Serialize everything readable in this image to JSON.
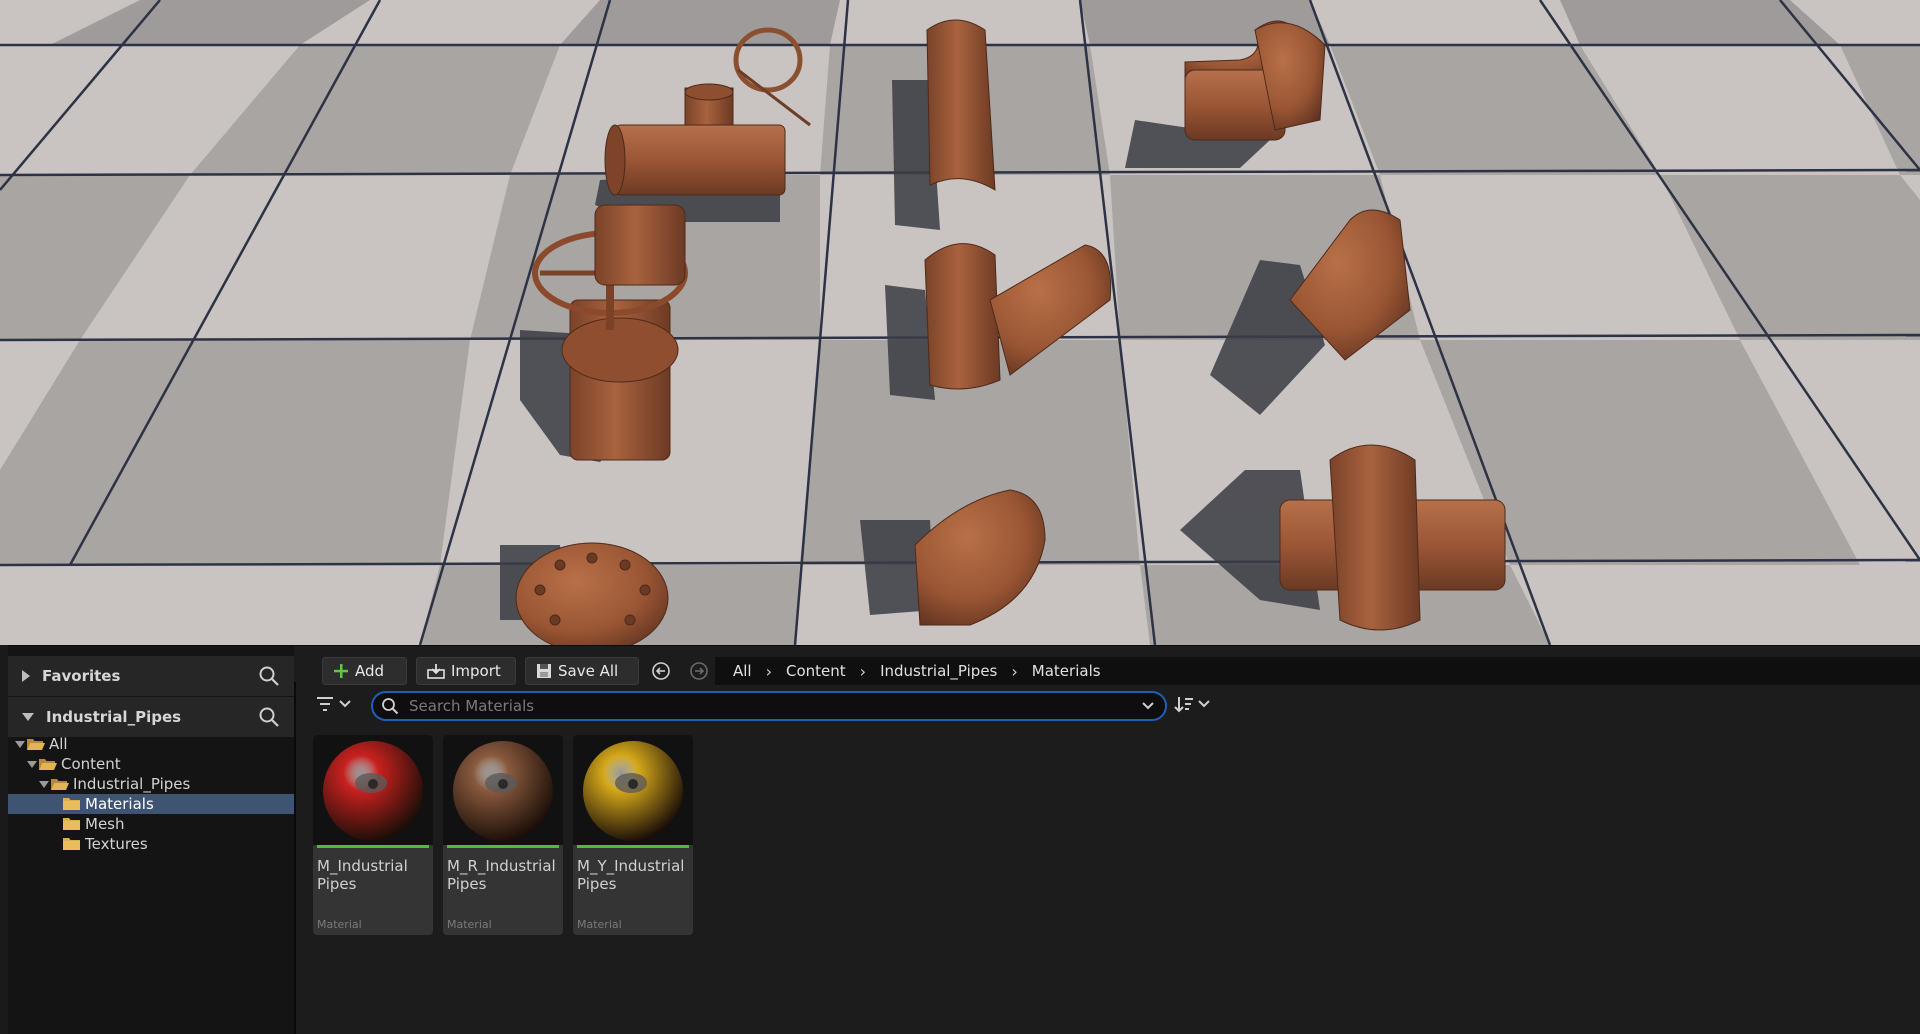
{
  "favorites": {
    "label": "Favorites"
  },
  "project_section": {
    "label": "Industrial_Pipes"
  },
  "tree": [
    {
      "label": "All",
      "depth": 0,
      "expanded": true,
      "selected": false
    },
    {
      "label": "Content",
      "depth": 1,
      "expanded": true,
      "selected": false
    },
    {
      "label": "Industrial_Pipes",
      "depth": 2,
      "expanded": true,
      "selected": false
    },
    {
      "label": "Materials",
      "depth": 3,
      "expanded": false,
      "selected": true
    },
    {
      "label": "Mesh",
      "depth": 3,
      "expanded": false,
      "selected": false
    },
    {
      "label": "Textures",
      "depth": 3,
      "expanded": false,
      "selected": false
    }
  ],
  "toolbar": {
    "add_label": "Add",
    "import_label": "Import",
    "save_all_label": "Save All"
  },
  "breadcrumb": [
    "All",
    "Content",
    "Industrial_Pipes",
    "Materials"
  ],
  "search": {
    "placeholder": "Search Materials"
  },
  "assets": [
    {
      "name": "M_Industrial Pipes",
      "line1": "M_Industrial",
      "line2": "Pipes",
      "type": "Material",
      "color": "#c8211f"
    },
    {
      "name": "M_R_Industrial Pipes",
      "line1": "M_R_Industrial",
      "line2": "Pipes",
      "type": "Material",
      "color": "#8a5a3e"
    },
    {
      "name": "M_Y_Industrial Pipes",
      "line1": "M_Y_Industrial",
      "line2": "Pipes",
      "type": "Material",
      "color": "#d4a81a"
    }
  ],
  "colors": {
    "accent_blue": "#1f5fb6",
    "selection": "#3f5372",
    "rust": "#9a5634",
    "asset_bar": "#4fbf2a"
  }
}
